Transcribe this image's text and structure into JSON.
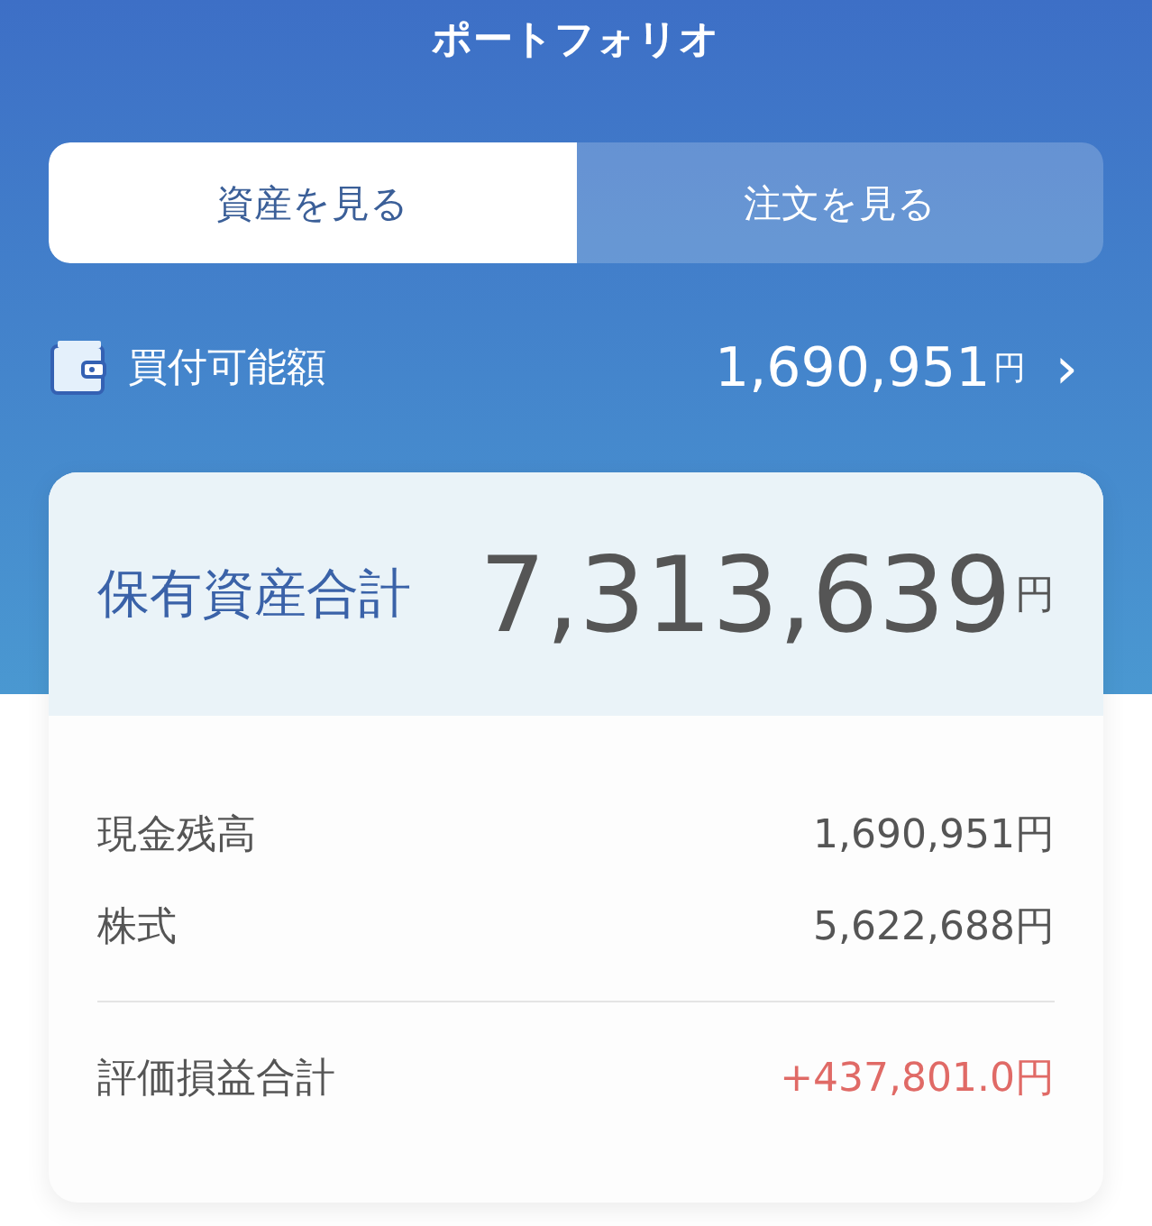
{
  "header": {
    "title": "ポートフォリオ"
  },
  "tabs": [
    {
      "label": "資産を見る",
      "selected": true
    },
    {
      "label": "注文を見る",
      "selected": false
    }
  ],
  "buying_power": {
    "label": "買付可能額",
    "value": "1,690,951",
    "unit": "円",
    "chevron": "›"
  },
  "summary": {
    "label": "保有資産合計",
    "value": "7,313,639",
    "unit": "円",
    "breakdown": [
      {
        "label": "現金残高",
        "value": "1,690,951円"
      },
      {
        "label": "株式",
        "value": "5,622,688円"
      }
    ],
    "profit_loss": {
      "label": "評価損益合計",
      "value": "+437,801.0円",
      "kind": "gain"
    }
  }
}
